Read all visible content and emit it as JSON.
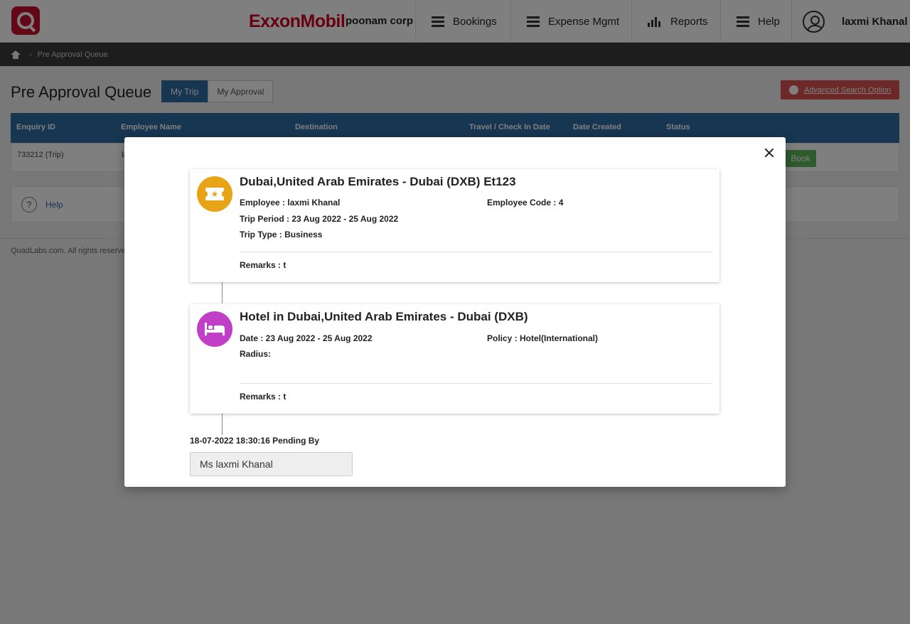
{
  "header": {
    "brand": "ExxonMobil",
    "company": "poonam corp",
    "nav": [
      {
        "label": "Bookings",
        "icon": "list-icon"
      },
      {
        "label": "Expense Mgmt",
        "icon": "list-icon"
      },
      {
        "label": "Reports",
        "icon": "bar-chart-icon"
      },
      {
        "label": "Help",
        "icon": "list-icon"
      }
    ],
    "user_name": "laxmi Khanal"
  },
  "breadcrumb": {
    "current": "Pre Approval Queue"
  },
  "page": {
    "title": "Pre Approval Queue",
    "tabs": [
      {
        "label": "My Trip",
        "active": true
      },
      {
        "label": "My Approval",
        "active": false
      }
    ],
    "advanced_search_label": "Advanced Search Option",
    "table": {
      "columns": [
        "Enquiry ID",
        "Employee Name",
        "Destination",
        "Travel / Check In Date",
        "Date Created",
        "Status"
      ],
      "rows": [
        {
          "enquiry_id": "733212 (Trip)",
          "employee_initial": "la",
          "action": "Book"
        }
      ]
    },
    "help_label": "Help",
    "footer": "QuadLabs.com. All rights reserved."
  },
  "modal": {
    "flight": {
      "title": "Dubai,United Arab Emirates - Dubai (DXB) Et123",
      "employee": "Employee : laxmi Khanal",
      "employee_code": "Employee Code : 4",
      "trip_period": "Trip Period : 23 Aug 2022 - 25 Aug 2022",
      "trip_type": "Trip Type : Business",
      "remarks": "Remarks :  t",
      "icon_color": "#e8a317"
    },
    "hotel": {
      "title": "Hotel in Dubai,United Arab Emirates - Dubai (DXB)",
      "date": "Date : 23 Aug 2022 - 25 Aug 2022",
      "policy": "Policy : Hotel(International)",
      "radius": "Radius:",
      "remarks": "Remarks : t",
      "icon_color": "#c13fc7"
    },
    "status_line": "18-07-2022 18:30:16 Pending By",
    "pending_by": "Ms laxmi Khanal"
  },
  "colors": {
    "primary": "#2e6da4",
    "danger": "#d9534f",
    "success": "#5cb85c",
    "brand_red": "#d2001e"
  }
}
